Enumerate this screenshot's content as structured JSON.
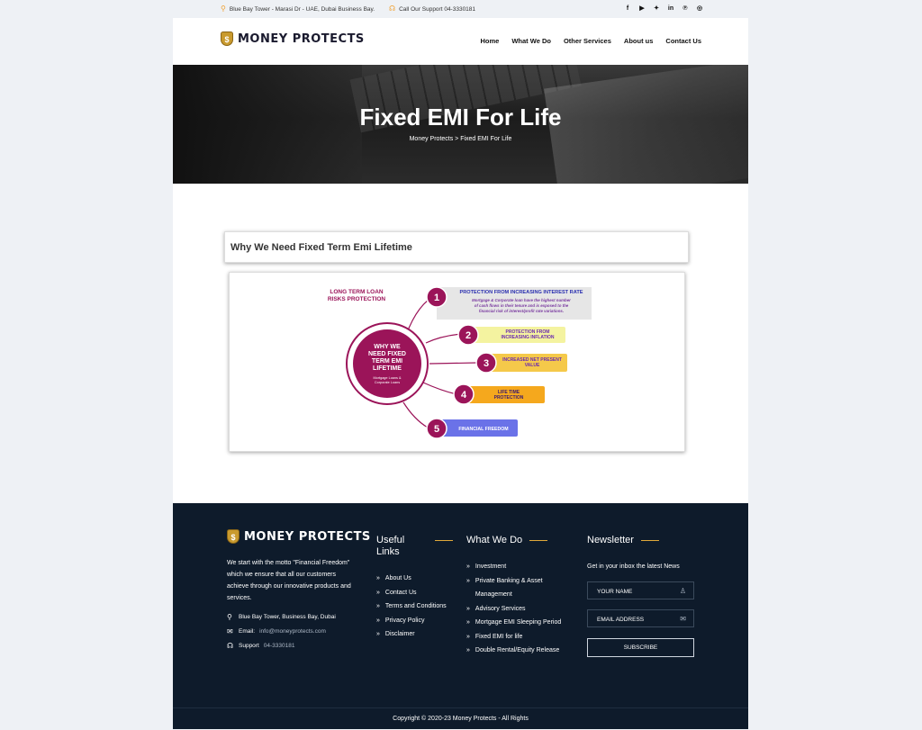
{
  "topbar": {
    "address": "Blue Bay Tower - Marasi Dr - UAE, Dubai Business Bay.",
    "call": "Call Our Support 04-3330181",
    "social_icons": [
      "facebook-icon",
      "youtube-icon",
      "twitter-icon",
      "linkedin-icon",
      "pinterest-icon",
      "instagram-icon"
    ]
  },
  "header": {
    "logo_text": "MONEY PROTECTS",
    "nav": [
      "Home",
      "What We Do",
      "Other Services",
      "About us",
      "Contact Us"
    ]
  },
  "hero": {
    "title": "Fixed EMI For Life",
    "breadcrumb": "Money Protects > Fixed EMI For Life"
  },
  "section": {
    "heading": "Why We Need Fixed Term Emi Lifetime"
  },
  "infographic": {
    "top_label_1": "LONG TERM LOAN",
    "top_label_2": "RISKS PROTECTION",
    "center_1": "WHY WE",
    "center_2": "NEED FIXED",
    "center_3": "TERM EMI",
    "center_4": "LIFETIME",
    "center_sub_1": "Mortgage Loans &",
    "center_sub_2": "Corporate Loans",
    "items": [
      {
        "num": "1",
        "title": "PROTECTION FROM INCREASING INTEREST RATE",
        "desc_1": "Mortgage & Corporate loan have the highest number",
        "desc_2": "of cash flows in their tenure and is exposed to the",
        "desc_3": "financial risk of interest/profit rate variations.",
        "color": "#e6e6e6"
      },
      {
        "num": "2",
        "title_1": "PROTECTION FROM",
        "title_2": "INCREASING INFLATION",
        "color": "#f4f3a0"
      },
      {
        "num": "3",
        "title_1": "INCREASED NET PRESENT",
        "title_2": "VALUE",
        "color": "#f5c94a"
      },
      {
        "num": "4",
        "title_1": "LIFE TIME",
        "title_2": "PROTECTION",
        "color": "#f5a81d"
      },
      {
        "num": "5",
        "title": "FINANCIAL FREEDOM",
        "color": "#6a72e8"
      }
    ],
    "accent": "#9b1459"
  },
  "footer": {
    "logo_text": "MONEY PROTECTS",
    "about": "We start with the motto \"Financial Freedom\" which we ensure that all our customers achieve through our innovative products and services.",
    "address": "Blue Bay Tower, Business Bay, Dubai",
    "email_label": "Email:",
    "email": "info@moneyprotects.com",
    "support_label": "Support",
    "support": "04-3330181",
    "useful_links_title_1": "Useful",
    "useful_links_title_2": "Links",
    "useful_links": [
      "About Us",
      "Contact Us",
      "Terms and Conditions",
      "Privacy Policy",
      "Disclaimer"
    ],
    "what_we_do_title": "What We Do",
    "what_we_do": [
      "Investment",
      "Private Banking & Asset",
      "Management",
      "Advisory Services",
      "Mortgage EMI Sleeping Period",
      "Fixed EMI for life",
      "Double Rental/Equity Release"
    ],
    "newsletter_title": "Newsletter",
    "newsletter_sub": "Get in your inbox the latest News",
    "name_placeholder": "YOUR NAME",
    "email_placeholder": "EMAIL ADDRESS",
    "subscribe": "SUBSCRIBE",
    "copyright": "Copyright © 2020-23 Money Protects - All Rights"
  },
  "colors": {
    "footer_bg": "#0e1b2b",
    "accent_gold": "#e0a93a",
    "icon_orange": "#f0a030"
  }
}
